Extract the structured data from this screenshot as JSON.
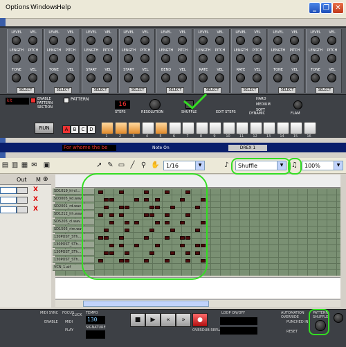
{
  "menu": [
    "Options",
    "Windows",
    "Help"
  ],
  "window_buttons": {
    "minimize": "_",
    "restore": "❐",
    "close": "✕"
  },
  "rack": {
    "channels": [
      {
        "knobs": [
          "LEVEL",
          "VEL",
          "LENGTH",
          "PITCH",
          "TONE",
          "VEL"
        ],
        "select": "SELECT"
      },
      {
        "knobs": [
          "LEVEL",
          "VEL",
          "LENGTH",
          "PITCH",
          "TONE",
          "VEL"
        ],
        "select": "SELECT"
      },
      {
        "knobs": [
          "LEVEL",
          "VEL",
          "LENGTH",
          "PITCH",
          "START",
          "VEL"
        ],
        "select": "SELECT"
      },
      {
        "knobs": [
          "LEVEL",
          "VEL",
          "LENGTH",
          "PITCH",
          "START",
          "VEL"
        ],
        "select": "SELECT"
      },
      {
        "knobs": [
          "LEVEL",
          "VEL",
          "LENGTH",
          "PITCH",
          "BEND",
          "VEL"
        ],
        "select": "SELECT"
      },
      {
        "knobs": [
          "LEVEL",
          "VEL",
          "LENGTH",
          "PITCH",
          "RATE",
          "VEL"
        ],
        "select": "SELECT"
      },
      {
        "knobs": [
          "LEVEL",
          "VEL",
          "LENGTH",
          "PITCH",
          "RATE",
          "VEL"
        ],
        "select": "SELECT"
      },
      {
        "knobs": [
          "LEVEL",
          "VEL",
          "LENGTH",
          "PITCH",
          "TONE",
          "VEL"
        ],
        "select": "SELECT"
      },
      {
        "knobs": [
          "LEVEL",
          "VEL",
          "LENGTH",
          "PITCH",
          "TONE",
          "VEL"
        ],
        "select": "SELECT"
      }
    ]
  },
  "control": {
    "enable_pattern": "ENABLE PATTERN SECTION",
    "pattern_label": "PATTERN",
    "run": "RUN",
    "bank_letters": [
      "A",
      "B",
      "C",
      "D"
    ],
    "steps_value": "16",
    "steps_label": "STEPS",
    "resolution_label": "RESOLUTION",
    "shuffle_label": "SHUFFLE",
    "edit_steps_label": "EDIT STEPS",
    "dynamic_label": "DYNAMIC",
    "dynamic_options": [
      "HARD",
      "MEDIUM",
      "SOFT"
    ],
    "flam_label": "FLAM",
    "step_count": 16,
    "active_steps": [
      1,
      2,
      3,
      5
    ]
  },
  "blue_bar": {
    "song": "For whome the be",
    "note_on": "Note On",
    "device_name": "DREX 1"
  },
  "toolbar": {
    "quantize": "1/16",
    "groove": "Shuffle",
    "zoom": "100%"
  },
  "editor": {
    "out_label": "Out",
    "m_label": "M",
    "drum_lanes": [
      "SD1019_hi-cl...",
      "SD3005_kd.wav",
      "SD2001_rd.wav",
      "SD1212_hh.wav",
      "SD5205_cl.wav",
      "SD1505_rim.wav",
      "130POST_STh...",
      "130POST_STh...",
      "130POST_STh...",
      "130POST_STh...",
      "VCN_1.aif"
    ]
  },
  "transport": {
    "midi_sync": "MIDI SYNC",
    "focus": "FOCUS",
    "enable": "ENABLE",
    "midi": "MIDI",
    "play": "PLAY",
    "click": "CLICK",
    "tempo": "TEMPO",
    "tempo_value": "130",
    "signature": "SIGNATURE",
    "overdub_replace": "OVERDUB REPLACE",
    "loop_on_off": "LOOP ON/OFF",
    "automation_override": "AUTOMATION OVERRIDE",
    "punched_in": "PUNCHED IN",
    "reset": "RESET",
    "pattern_shuffle": "PATTERN SHUFFLE"
  },
  "colors": {
    "annotation": "#33dd22",
    "accent_step": "#e08a2a",
    "note": "#4a0a0a"
  }
}
